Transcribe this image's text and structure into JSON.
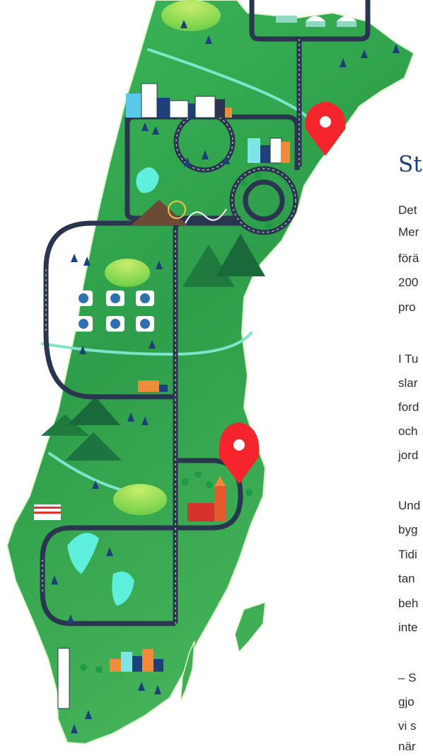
{
  "article": {
    "heading": "St",
    "paragraphs": [
      [
        "Det",
        "Mer",
        "förä",
        "200",
        "pro"
      ],
      [
        "I Tu",
        "slar",
        "ford",
        "och",
        "jord"
      ],
      [
        "Und",
        "byg",
        "Tidi",
        "tan",
        "beh",
        "inte"
      ],
      [
        "– S",
        "gjo",
        "vi s",
        "när"
      ]
    ]
  },
  "map": {
    "location_pin_color": "#f4262b",
    "land_color": "#2fa84f",
    "road_color": "#2a3550",
    "water_color": "#6ee7e0",
    "icons": [
      "location-pin-icon",
      "tree-icon",
      "mountain-icon",
      "stadium-icon",
      "church-icon",
      "ferris-wheel-icon",
      "rollercoaster-icon",
      "lake-icon",
      "city-icon",
      "greenhouse-icon"
    ]
  }
}
